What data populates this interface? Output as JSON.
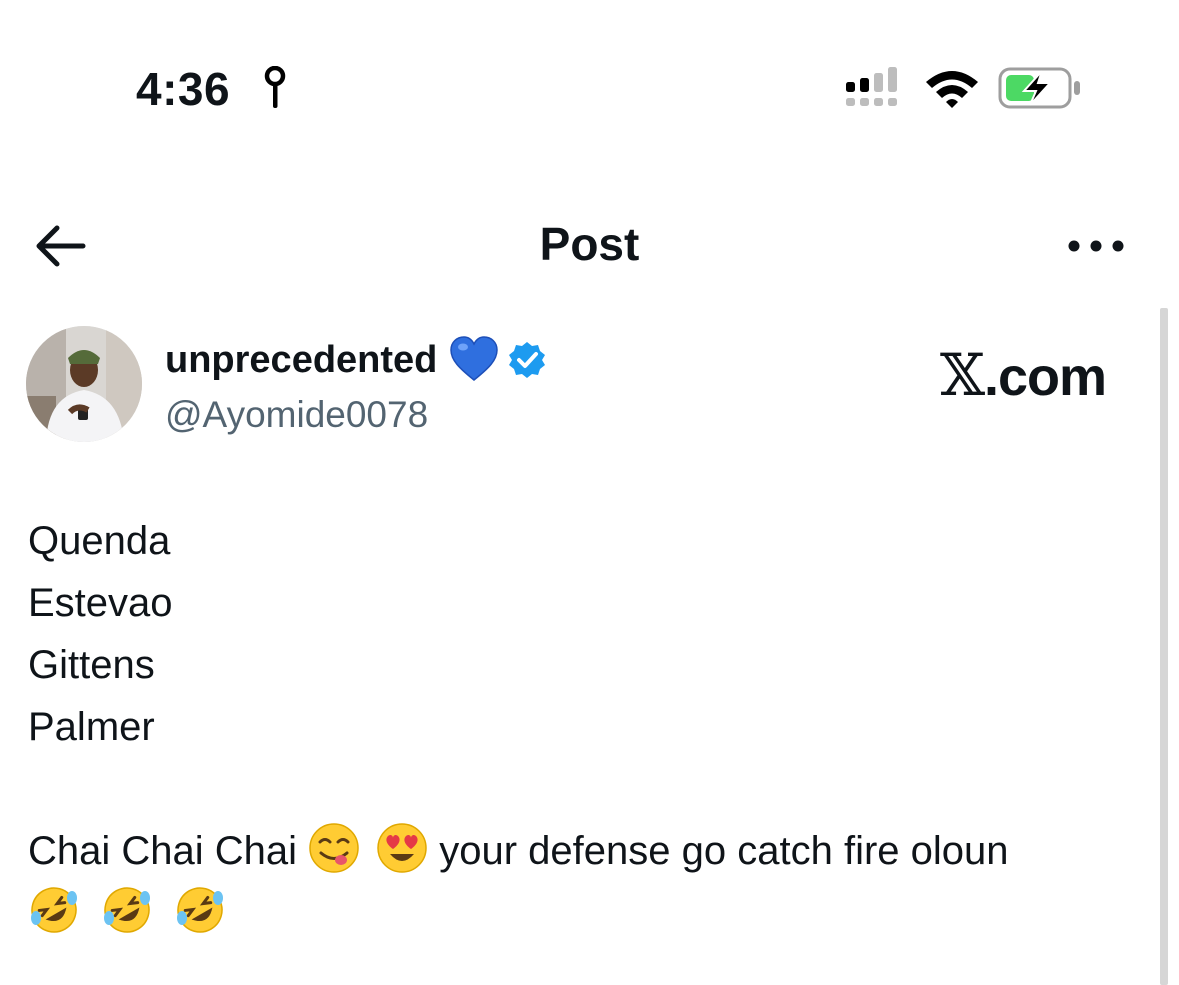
{
  "status_bar": {
    "time": "4:36",
    "icons": [
      "location-icon",
      "signal-icon",
      "wifi-icon",
      "battery-charging-icon"
    ],
    "battery_color": "#4cd964"
  },
  "header": {
    "title": "Post",
    "back_icon": "arrow-left-icon",
    "more_icon": "more-horizontal-icon"
  },
  "post": {
    "author": {
      "name": "unprecedented",
      "name_emoji": "blue-heart",
      "handle": "@Ayomide0078",
      "verified": true,
      "verified_color": "#1d9bf0"
    },
    "watermark": {
      "x": "𝕏",
      "domain": ".com"
    },
    "lines": [
      "Quenda",
      "Estevao",
      "Gittens",
      "Palmer"
    ],
    "closing": {
      "part1": "Chai Chai Chai ",
      "emoji1": "face-savoring-food",
      "emoji2": "smiling-face-with-heart-eyes",
      "part2": " your defense go catch fire oloun",
      "trailing_emojis": [
        "rolling-on-the-floor-laughing",
        "rolling-on-the-floor-laughing",
        "rolling-on-the-floor-laughing"
      ]
    }
  }
}
